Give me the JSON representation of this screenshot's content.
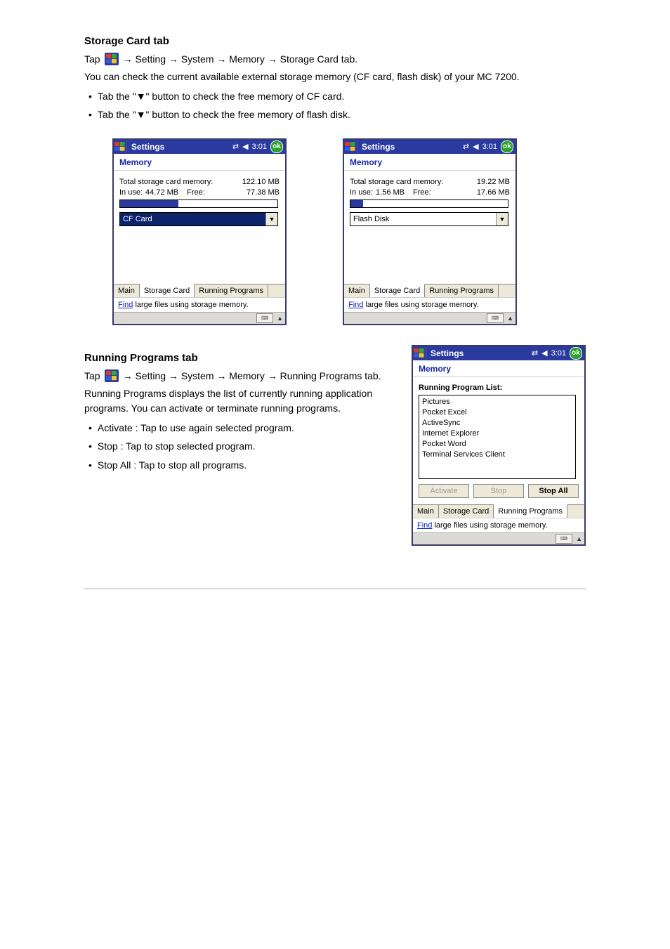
{
  "section1": {
    "title": "Storage Card tab",
    "intro_prefix": "Tap",
    "intro_suffix": "→ Setting → System → Memory → Storage Card tab.",
    "para": "You can check the current available external storage memory (CF card, flash disk) of your MC 7200.",
    "bullet1": "Tab the \"▼\" button to check the free memory of CF card.",
    "bullet2": "Tab the \"▼\" button to check the free memory of flash disk."
  },
  "left_card": {
    "title": "Settings",
    "time": "3:01",
    "ok": "ok",
    "subhead": "Memory",
    "total_label": "Total storage card memory:",
    "total_value": "122.10 MB",
    "inuse_label": "In use:",
    "inuse_value": "44.72 MB",
    "free_label": "Free:",
    "free_value": "77.38 MB",
    "dd_value": "CF Card",
    "tab_main": "Main",
    "tab_storage": "Storage Card",
    "tab_running": "Running Programs",
    "find_link": "Find",
    "find_rest": " large files using storage memory."
  },
  "right_card": {
    "title": "Settings",
    "time": "3:01",
    "ok": "ok",
    "subhead": "Memory",
    "total_label": "Total storage card memory:",
    "total_value": "19.22 MB",
    "inuse_label": "In use:",
    "inuse_value": "1.56 MB",
    "free_label": "Free:",
    "free_value": "17.66 MB",
    "dd_value": "Flash Disk",
    "tab_main": "Main",
    "tab_storage": "Storage Card",
    "tab_running": "Running Programs",
    "find_link": "Find",
    "find_rest": " large files using storage memory."
  },
  "section2": {
    "title": "Running Programs tab",
    "intro_prefix": "Tap",
    "intro_suffix": "→ Setting → System → Memory → Running Programs tab.",
    "para": "Running Programs displays the list of currently running application programs. You can activate or terminate running programs.",
    "b1": "Activate : Tap to use again selected program.",
    "b2": "Stop : Tap to stop selected program.",
    "b3": "Stop All : Tap to stop all programs."
  },
  "run_card": {
    "title": "Settings",
    "time": "3:01",
    "ok": "ok",
    "subhead": "Memory",
    "list_title": "Running Program List:",
    "programs": [
      "Pictures",
      "Pocket Excel",
      "ActiveSync",
      "Internet Explorer",
      "Pocket Word",
      "Terminal Services Client"
    ],
    "btn_activate": "Activate",
    "btn_stop": "Stop",
    "btn_stopall": "Stop All",
    "tab_main": "Main",
    "tab_storage": "Storage Card",
    "tab_running": "Running Programs",
    "find_link": "Find",
    "find_rest": " large files using storage memory."
  }
}
